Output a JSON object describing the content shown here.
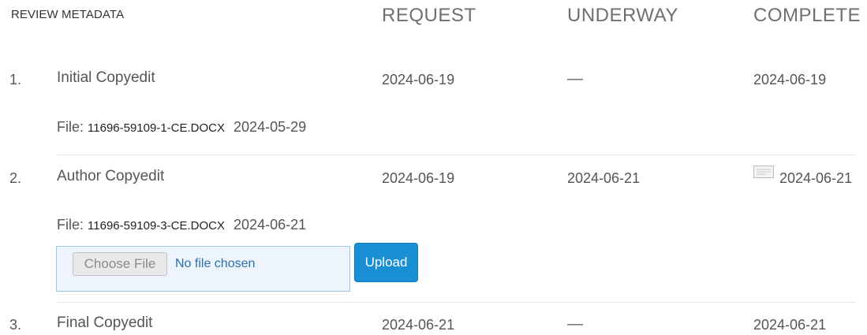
{
  "header": {
    "metadata": "REVIEW METADATA",
    "request": "REQUEST",
    "underway": "UNDERWAY",
    "complete": "COMPLETE"
  },
  "steps": [
    {
      "number": "1.",
      "name": "Initial Copyedit",
      "request": "2024-06-19",
      "underway": "—",
      "complete": "2024-06-19",
      "file_label": "File:",
      "file_name": "11696-59109-1-CE.DOCX",
      "file_date": "2024-05-29"
    },
    {
      "number": "2.",
      "name": "Author Copyedit",
      "request": "2024-06-19",
      "underway": "2024-06-21",
      "complete": "2024-06-21",
      "complete_icon": "notes-icon",
      "file_label": "File:",
      "file_name": "11696-59109-3-CE.DOCX",
      "file_date": "2024-06-21"
    },
    {
      "number": "3.",
      "name": "Final Copyedit",
      "request": "2024-06-21",
      "underway": "—",
      "complete": "2024-06-21"
    }
  ],
  "upload": {
    "choose_label": "Choose File",
    "no_file_text": "No file chosen",
    "upload_label": "Upload"
  }
}
